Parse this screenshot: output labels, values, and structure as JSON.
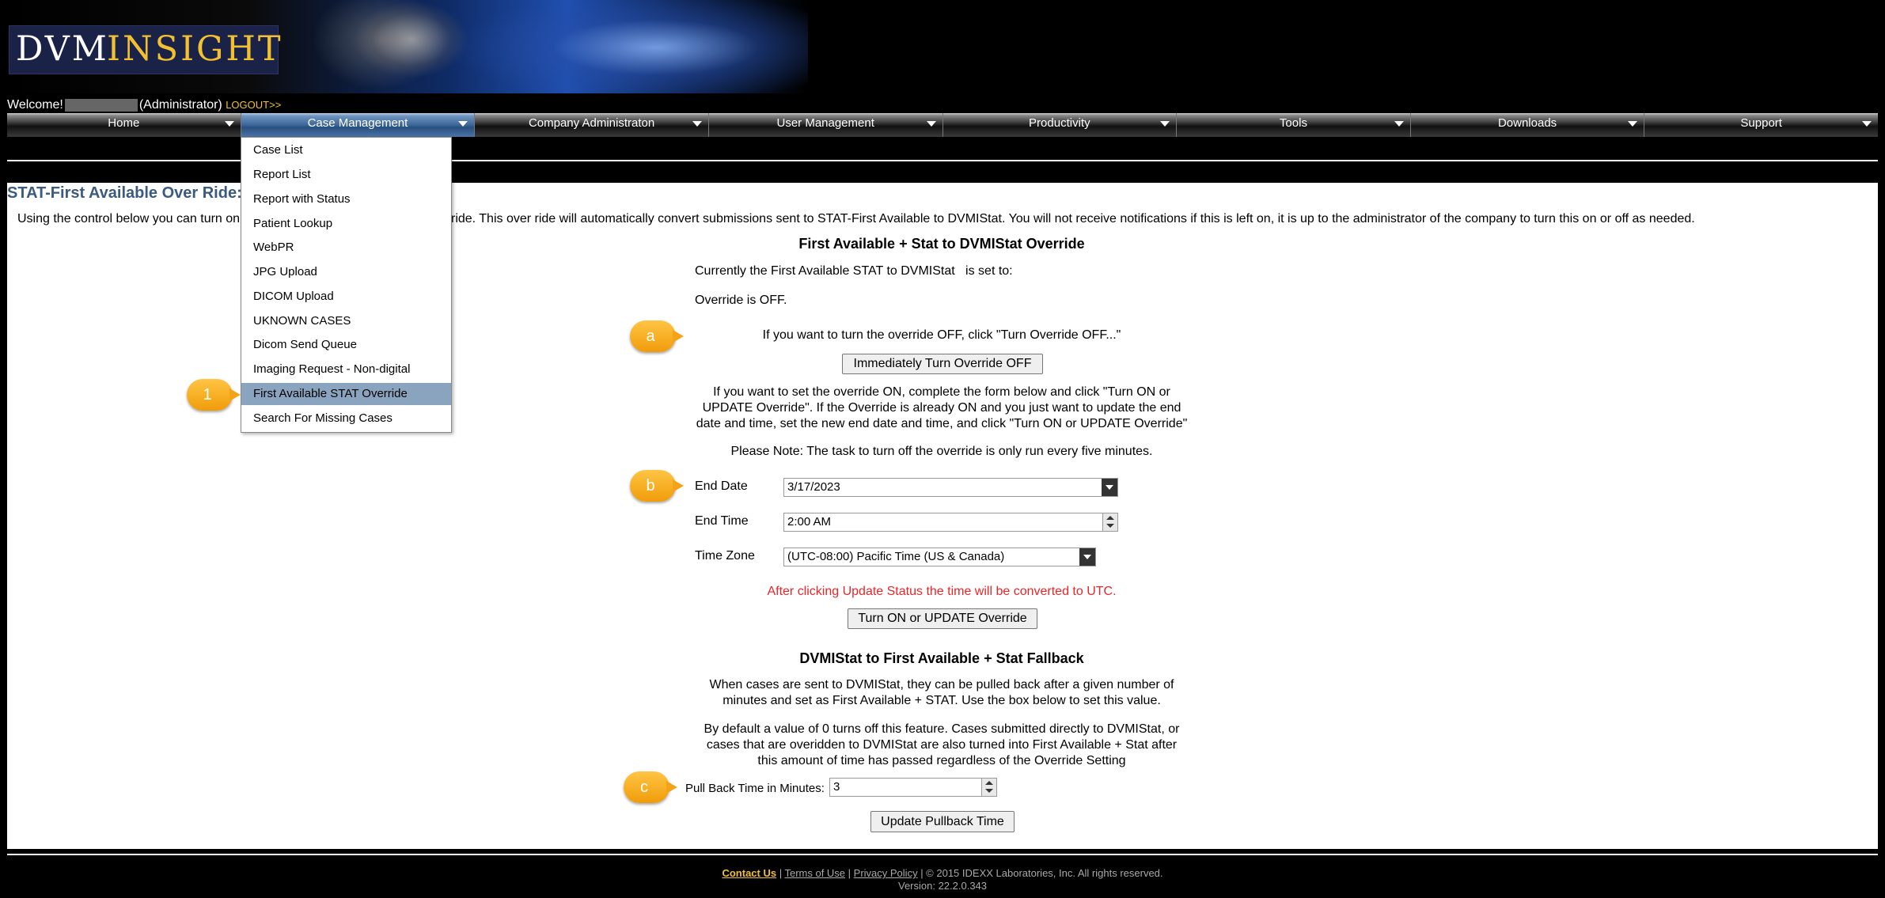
{
  "logo": {
    "part1": "DVM",
    "part2": "INSIGHT"
  },
  "welcome": {
    "prefix": "Welcome!",
    "role": "(Administrator)",
    "logout": "LOGOUT>>"
  },
  "nav": {
    "items": [
      {
        "label": "Home"
      },
      {
        "label": "Case Management"
      },
      {
        "label": "Company Administraton"
      },
      {
        "label": "User Management"
      },
      {
        "label": "Productivity"
      },
      {
        "label": "Tools"
      },
      {
        "label": "Downloads"
      },
      {
        "label": "Support"
      }
    ],
    "active_index": 1
  },
  "dropdown": {
    "items": [
      {
        "label": "Case List"
      },
      {
        "label": "Report List"
      },
      {
        "label": "Report with Status"
      },
      {
        "label": "Patient Lookup"
      },
      {
        "label": "WebPR"
      },
      {
        "label": "JPG Upload"
      },
      {
        "label": "DICOM Upload"
      },
      {
        "label": "UKNOWN CASES"
      },
      {
        "label": "Dicom Send Queue"
      },
      {
        "label": "Imaging Request - Non-digital"
      },
      {
        "label": "First Available STAT Override"
      },
      {
        "label": "Search For Missing Cases"
      }
    ],
    "selected_index": 10
  },
  "page": {
    "title": "STAT-First Available Over Ride:",
    "intro_left": "Using the control below you can turn on",
    "intro_right": "ride. This over ride will automatically convert submissions sent to STAT-First Available to DVMIStat. You will not receive notifications if this is left on, it is up to the administrator of the company to turn this on or off as needed."
  },
  "override": {
    "heading": "First Available + Stat to DVMIStat Override",
    "current_label": "Currently the First Available STAT to DVMIStat   is set to:",
    "status": "Override is OFF.",
    "off_instruction": "If you want to turn the override OFF, click \"Turn Override OFF...\"",
    "off_button": "Immediately Turn Override OFF",
    "on_instruction_1": "If you want to set the override ON, complete the form below and click \"Turn ON or",
    "on_instruction_2": "UPDATE Override\".  If the Override is already ON and you just want to update the end",
    "on_instruction_3": "date and time, set the new end date and time, and click \"Turn ON or UPDATE Override\"",
    "note": "Please Note:  The task to turn off the override is only run every five minutes.",
    "end_date_label": "End Date",
    "end_date_value": "3/17/2023",
    "end_time_label": "End Time",
    "end_time_value": "2:00 AM",
    "timezone_label": "Time Zone",
    "timezone_value": "(UTC-08:00) Pacific Time (US & Canada)",
    "utc_warning": "After clicking Update Status the time will be converted to UTC.",
    "update_button": "Turn ON or UPDATE Override"
  },
  "fallback": {
    "heading": "DVMIStat to First Available + Stat Fallback",
    "desc1_line1": "When cases are sent to DVMIStat, they can be pulled back after a given number of",
    "desc1_line2": "minutes and set as First Available + STAT. Use the box below to set this value.",
    "desc2_line1": "By default a value of 0 turns off this feature.  Cases submitted directly to DVMIStat, or",
    "desc2_line2": "cases that are overidden to DVMIStat are also turned into First Available + Stat after",
    "desc2_line3": "this amount of time has passed regardless of the Override Setting",
    "pullback_label": "Pull Back Time in Minutes:",
    "pullback_value": "3",
    "pullback_button": "Update Pullback Time"
  },
  "callouts": {
    "c1": "1",
    "ca": "a",
    "cb": "b",
    "cc": "c"
  },
  "footer": {
    "contact": "Contact Us",
    "sep": " | ",
    "terms": "Terms of Use",
    "privacy": "Privacy Policy",
    "copyright": " | © 2015 IDEXX Laboratories, Inc. All rights reserved.",
    "version": "Version: 22.2.0.343"
  },
  "colors": {
    "accent": "#f2c132",
    "title": "#3a5a80",
    "warning": "#e8262a",
    "callout": "#f5a623",
    "menu_selected": "#8aa3bf"
  }
}
